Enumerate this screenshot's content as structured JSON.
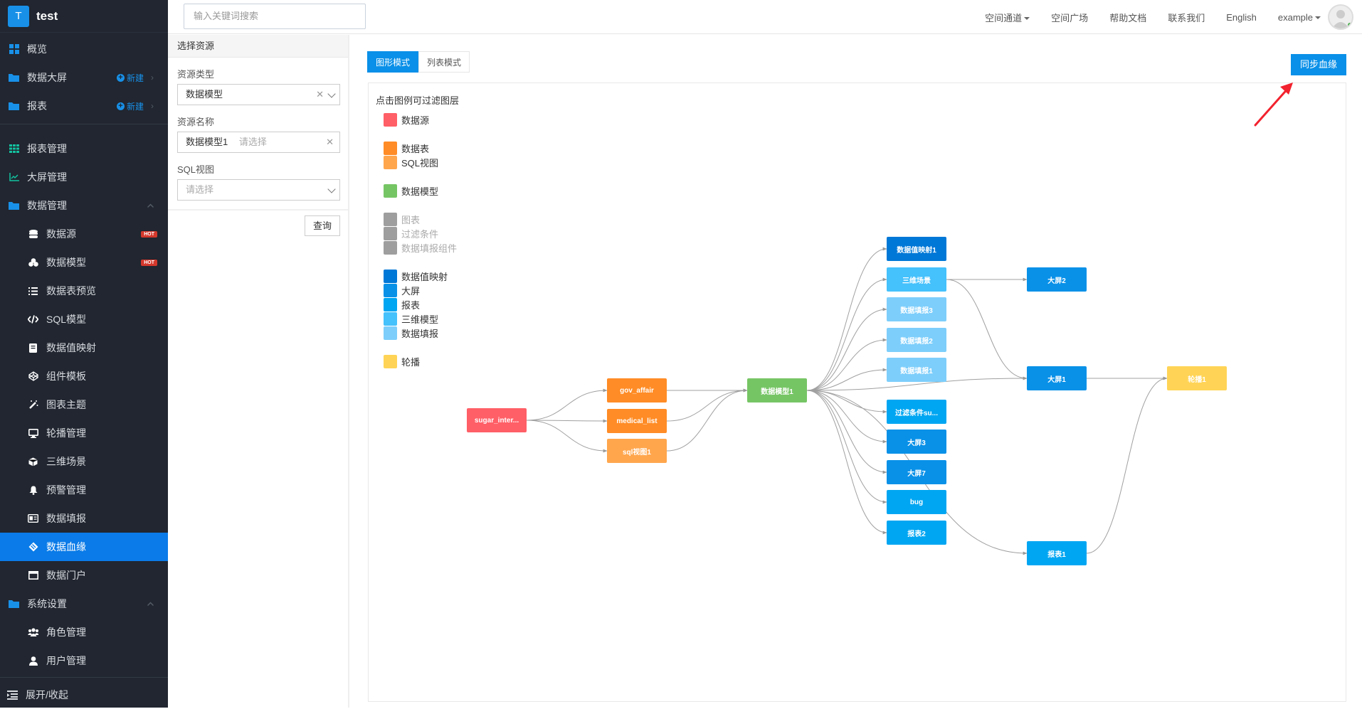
{
  "app": {
    "logo_letter": "T",
    "name": "test"
  },
  "sidebar": {
    "items": [
      {
        "label": "概览",
        "icon": "dashboard-grid-icon",
        "level": "top"
      },
      {
        "label": "数据大屏",
        "icon": "folder-icon",
        "level": "top",
        "new_label": "新建"
      },
      {
        "label": "报表",
        "icon": "folder-icon",
        "level": "top",
        "new_label": "新建"
      },
      {
        "label": "报表管理",
        "icon": "table-grid-icon",
        "level": "top"
      },
      {
        "label": "大屏管理",
        "icon": "line-chart-icon",
        "level": "top"
      },
      {
        "label": "数据管理",
        "icon": "folder-icon",
        "level": "top",
        "expanded": true
      },
      {
        "label": "数据源",
        "icon": "database-icon",
        "level": "sub",
        "badge": "HOT"
      },
      {
        "label": "数据模型",
        "icon": "cubes-icon",
        "level": "sub",
        "badge": "HOT"
      },
      {
        "label": "数据表预览",
        "icon": "list-icon",
        "level": "sub"
      },
      {
        "label": "SQL模型",
        "icon": "code-icon",
        "level": "sub"
      },
      {
        "label": "数据值映射",
        "icon": "book-icon",
        "level": "sub"
      },
      {
        "label": "组件模板",
        "icon": "codepen-icon",
        "level": "sub"
      },
      {
        "label": "图表主题",
        "icon": "magic-wand-icon",
        "level": "sub"
      },
      {
        "label": "轮播管理",
        "icon": "monitor-icon",
        "level": "sub"
      },
      {
        "label": "三维场景",
        "icon": "cube-icon",
        "level": "sub"
      },
      {
        "label": "预警管理",
        "icon": "bell-icon",
        "level": "sub"
      },
      {
        "label": "数据填报",
        "icon": "id-card-icon",
        "level": "sub"
      },
      {
        "label": "数据血缘",
        "icon": "lineage-icon",
        "level": "sub",
        "active": true
      },
      {
        "label": "数据门户",
        "icon": "window-icon",
        "level": "sub"
      },
      {
        "label": "系统设置",
        "icon": "folder-icon",
        "level": "top",
        "expanded": true
      },
      {
        "label": "角色管理",
        "icon": "users-icon",
        "level": "sub"
      },
      {
        "label": "用户管理",
        "icon": "user-icon",
        "level": "sub"
      }
    ],
    "collapse_label": "展开/收起"
  },
  "header": {
    "search_placeholder": "输入关键词搜索",
    "nav": [
      "空间通道",
      "空间广场",
      "帮助文档",
      "联系我们",
      "English"
    ],
    "user": "example"
  },
  "panel": {
    "title": "选择资源",
    "resource_type_label": "资源类型",
    "resource_type_value": "数据模型",
    "resource_name_label": "资源名称",
    "resource_name_value": "数据模型1",
    "resource_name_placeholder": "请选择",
    "sql_view_label": "SQL视图",
    "sql_view_placeholder": "请选择",
    "query_button": "查询"
  },
  "main": {
    "tabs": [
      {
        "label": "图形模式",
        "active": true
      },
      {
        "label": "列表模式",
        "active": false
      }
    ],
    "sync_button": "同步血缘",
    "legend_hint": "点击图例可过滤图层",
    "legend": [
      {
        "label": "数据源",
        "color": "#ff5f67",
        "dim": false
      },
      {
        "label": "数据表",
        "color": "#ff8c26",
        "dim": false
      },
      {
        "label": "SQL视图",
        "color": "#ffa64d",
        "dim": false
      },
      {
        "label": "数据模型",
        "color": "#76c565",
        "dim": false
      },
      {
        "label": "图表",
        "color": "#9e9e9e",
        "dim": true
      },
      {
        "label": "过滤条件",
        "color": "#9e9e9e",
        "dim": true
      },
      {
        "label": "数据填报组件",
        "color": "#9e9e9e",
        "dim": true
      },
      {
        "label": "数据值映射",
        "color": "#0078d7",
        "dim": false
      },
      {
        "label": "大屏",
        "color": "#0991e8",
        "dim": false
      },
      {
        "label": "报表",
        "color": "#00a6f2",
        "dim": false
      },
      {
        "label": "三维模型",
        "color": "#45c1fc",
        "dim": false
      },
      {
        "label": "数据填报",
        "color": "#7dcefb",
        "dim": false
      },
      {
        "label": "轮播",
        "color": "#ffd456",
        "dim": false
      }
    ]
  },
  "graph": {
    "nodes": [
      {
        "id": "n0",
        "label": "sugar_inter...",
        "type": "数据源"
      },
      {
        "id": "n1",
        "label": "gov_affair",
        "type": "数据表"
      },
      {
        "id": "n2",
        "label": "medical_list",
        "type": "数据表"
      },
      {
        "id": "n3",
        "label": "sql视图1",
        "type": "SQL视图"
      },
      {
        "id": "n4",
        "label": "数据模型1",
        "type": "数据模型"
      },
      {
        "id": "n5",
        "label": "数据值映射1",
        "type": "数据值映射"
      },
      {
        "id": "n6",
        "label": "三维场景",
        "type": "三维模型"
      },
      {
        "id": "n7",
        "label": "数据填报3",
        "type": "数据填报"
      },
      {
        "id": "n8",
        "label": "数据填报2",
        "type": "数据填报"
      },
      {
        "id": "n9",
        "label": "数据填报1",
        "type": "数据填报"
      },
      {
        "id": "n10",
        "label": "过滤条件su...",
        "type": "报表"
      },
      {
        "id": "n11",
        "label": "大屏3",
        "type": "大屏"
      },
      {
        "id": "n12",
        "label": "大屏7",
        "type": "大屏"
      },
      {
        "id": "n13",
        "label": "bug",
        "type": "报表"
      },
      {
        "id": "n14",
        "label": "报表2",
        "type": "报表"
      },
      {
        "id": "n15",
        "label": "大屏2",
        "type": "大屏"
      },
      {
        "id": "n16",
        "label": "大屏1",
        "type": "大屏"
      },
      {
        "id": "n17",
        "label": "报表1",
        "type": "报表"
      },
      {
        "id": "n18",
        "label": "轮播1",
        "type": "轮播"
      }
    ],
    "edges": [
      [
        "n0",
        "n1"
      ],
      [
        "n0",
        "n2"
      ],
      [
        "n0",
        "n3"
      ],
      [
        "n1",
        "n4"
      ],
      [
        "n2",
        "n4"
      ],
      [
        "n3",
        "n4"
      ],
      [
        "n4",
        "n5"
      ],
      [
        "n4",
        "n6"
      ],
      [
        "n4",
        "n7"
      ],
      [
        "n4",
        "n8"
      ],
      [
        "n4",
        "n9"
      ],
      [
        "n4",
        "n16"
      ],
      [
        "n4",
        "n10"
      ],
      [
        "n4",
        "n11"
      ],
      [
        "n4",
        "n12"
      ],
      [
        "n4",
        "n13"
      ],
      [
        "n4",
        "n14"
      ],
      [
        "n4",
        "n17"
      ],
      [
        "n6",
        "n15"
      ],
      [
        "n6",
        "n16"
      ],
      [
        "n16",
        "n18"
      ],
      [
        "n17",
        "n18"
      ]
    ]
  }
}
